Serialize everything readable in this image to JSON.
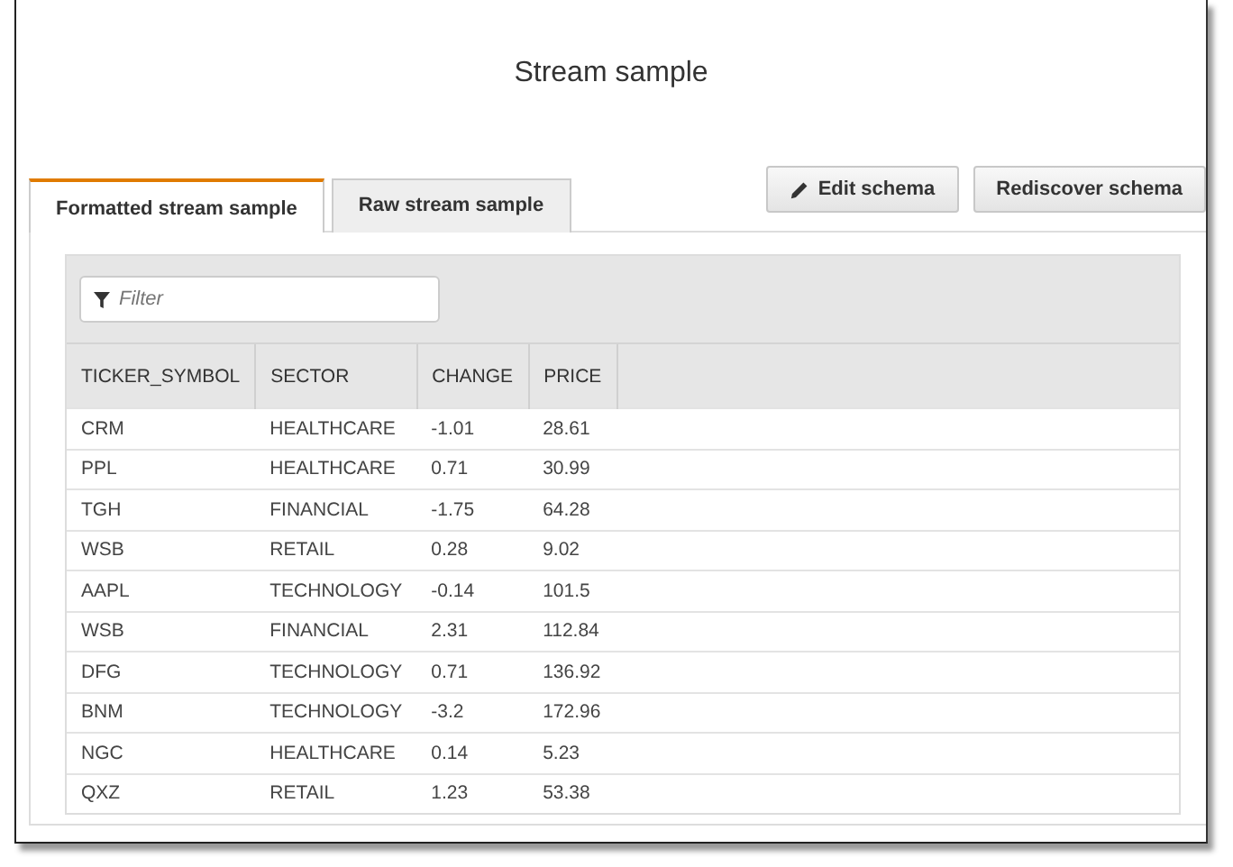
{
  "title": "Stream sample",
  "tabs": [
    {
      "label": "Formatted stream sample",
      "selected": true
    },
    {
      "label": "Raw stream sample",
      "selected": false
    }
  ],
  "buttons": [
    {
      "label": "Edit schema",
      "kind": "edit"
    },
    {
      "label": "Rediscover schema",
      "kind": "plain"
    }
  ],
  "filter": {
    "placeholder": "Filter"
  },
  "table": {
    "columns": [
      "TICKER_SYMBOL",
      "SECTOR",
      "CHANGE",
      "PRICE"
    ],
    "rows": [
      [
        "CRM",
        "HEALTHCARE",
        "-1.01",
        "28.61"
      ],
      [
        "PPL",
        "HEALTHCARE",
        "0.71",
        "30.99"
      ],
      [
        "TGH",
        "FINANCIAL",
        "-1.75",
        "64.28"
      ],
      [
        "WSB",
        "RETAIL",
        "0.28",
        "9.02"
      ],
      [
        "AAPL",
        "TECHNOLOGY",
        "-0.14",
        "101.5"
      ],
      [
        "WSB",
        "FINANCIAL",
        "2.31",
        "112.84"
      ],
      [
        "DFG",
        "TECHNOLOGY",
        "0.71",
        "136.92"
      ],
      [
        "BNM",
        "TECHNOLOGY",
        "-3.2",
        "172.96"
      ],
      [
        "NGC",
        "HEALTHCARE",
        "0.14",
        "5.23"
      ],
      [
        "QXZ",
        "RETAIL",
        "1.23",
        "53.38"
      ]
    ]
  }
}
